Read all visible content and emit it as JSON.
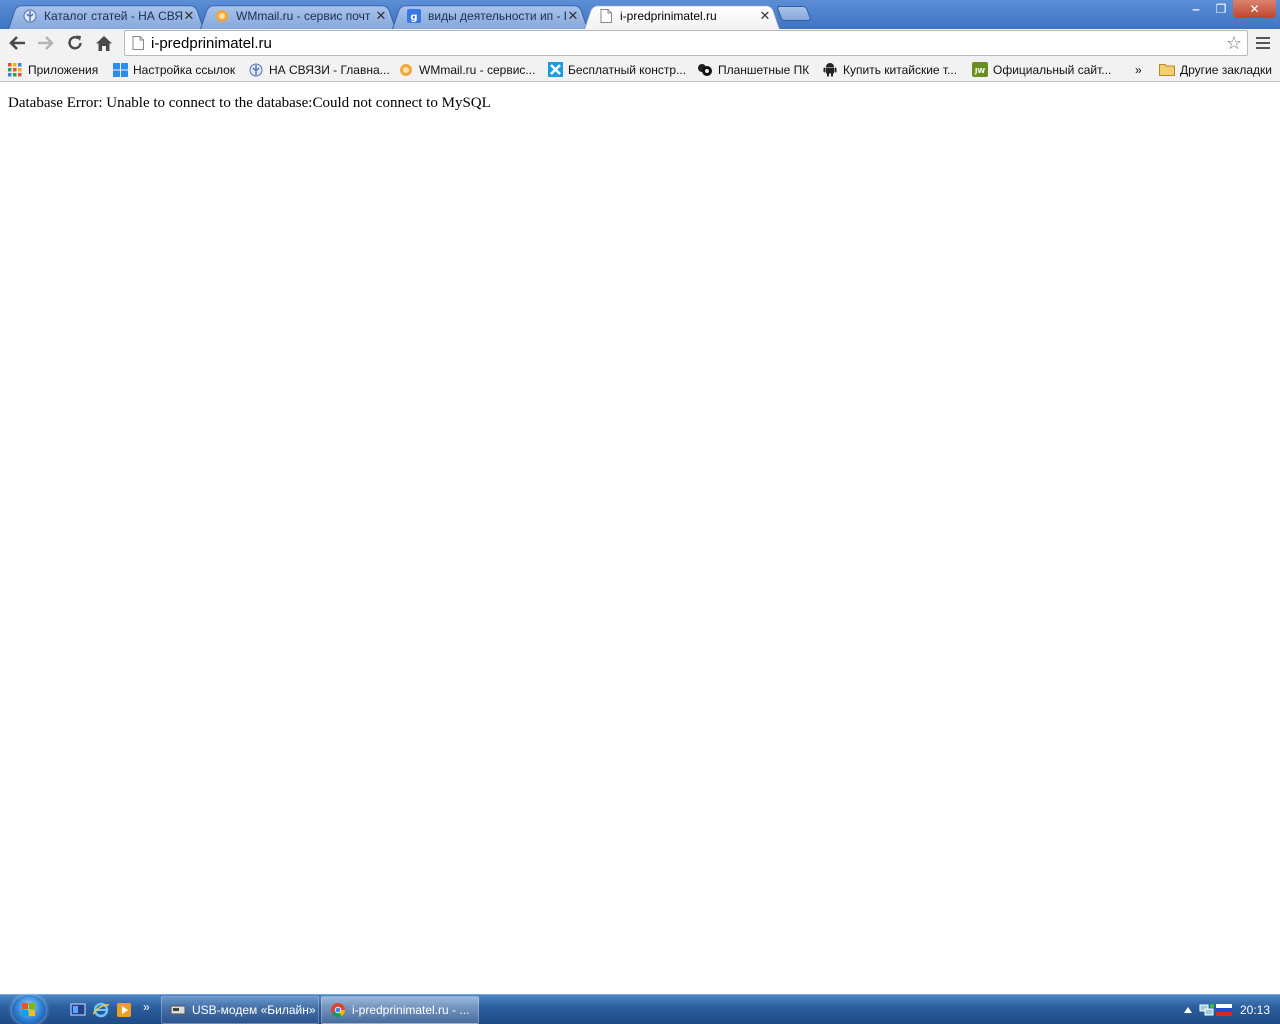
{
  "tabs": [
    {
      "title": "Каталог статей - НА СВЯЗ",
      "icon": "nasvyazi-icon",
      "active": false
    },
    {
      "title": "WMmail.ru - сервис почт",
      "icon": "wmmail-icon",
      "active": false
    },
    {
      "title": "виды деятельности ип - П",
      "icon": "google-icon",
      "active": false
    },
    {
      "title": "i-predprinimatel.ru",
      "icon": "page-icon",
      "active": true
    }
  ],
  "window_controls": {
    "minimize": "‒",
    "maximize": "❐",
    "close": "✕"
  },
  "toolbar": {
    "url": "i-predprinimatel.ru"
  },
  "bookmarks": [
    {
      "label": "Приложения",
      "icon": "apps-grid-icon"
    },
    {
      "label": "Настройка ссылок",
      "icon": "windows-flag-icon"
    },
    {
      "label": "НА СВЯЗИ - Главна...",
      "icon": "nasvyazi-icon"
    },
    {
      "label": "WMmail.ru - сервис...",
      "icon": "wmmail-icon"
    },
    {
      "label": "Бесплатный констр...",
      "icon": "ucoz-icon"
    },
    {
      "label": "Планшетные ПК",
      "icon": "tablet-icon"
    },
    {
      "label": "Купить китайские т...",
      "icon": "android-icon"
    },
    {
      "label": "Официальный сайт...",
      "icon": "jw-icon"
    }
  ],
  "bookmarks_overflow": "»",
  "other_bookmarks": "Другие закладки",
  "content": {
    "error_message": "Database Error: Unable to connect to the database:Could not connect to MySQL"
  },
  "taskbar": {
    "quicklaunch_more": "»",
    "tasks": [
      {
        "label": "USB-модем «Билайн»",
        "icon": "modem-icon",
        "active": false
      },
      {
        "label": "i-predprinimatel.ru - ...",
        "icon": "chrome-icon",
        "active": true
      }
    ],
    "clock": "20:13"
  },
  "colors": {
    "tabstrip": "#4a7fcf",
    "taskbar": "#2c5f9e",
    "content_bg": "#ffffff"
  }
}
